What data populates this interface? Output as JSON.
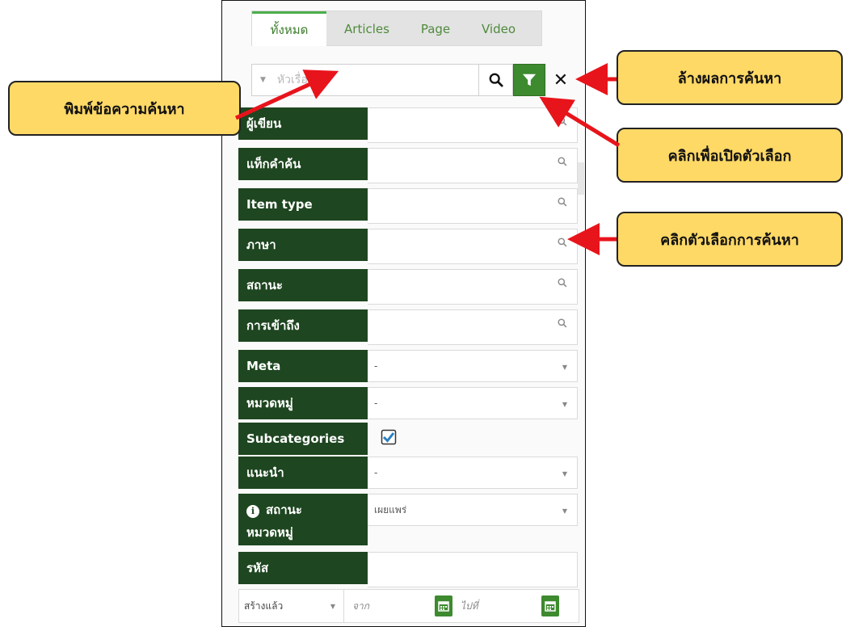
{
  "tabs": [
    "ทั้งหมด",
    "Articles",
    "Page",
    "Video"
  ],
  "search": {
    "placeholder": "หัวเรื่อง"
  },
  "filters": {
    "author": "ผู้เขียน",
    "tags": "แท็กคำค้น",
    "item_type": "Item type",
    "language": "ภาษา",
    "status": "สถานะ",
    "access": "การเข้าถึง",
    "meta": {
      "label": "Meta",
      "value": "-"
    },
    "category": {
      "label": "หมวดหมู่",
      "value": "-"
    },
    "subcategories": {
      "label": "Subcategories",
      "checked": true
    },
    "featured": {
      "label": "แนะนำ",
      "value": "-"
    },
    "category_status": {
      "label_line1": "สถานะ",
      "label_line2": "หมวดหมู่",
      "value": "เผยแพร่"
    },
    "id": "รหัส",
    "date": {
      "type": "สร้างแล้ว",
      "from_placeholder": "จาก",
      "to_placeholder": "ไปที่"
    }
  },
  "callouts": {
    "type_search": "พิมพ์ข้อความค้นหา",
    "clear_results": "ล้างผลการค้นหา",
    "open_options": "คลิกเพื่อเปิดตัวเลือก",
    "search_options": "คลิกตัวเลือกการค้นหา"
  },
  "colors": {
    "label_bg": "#1e4620",
    "accent_green": "#3d8a2f",
    "callout_bg": "#ffd966",
    "arrow": "#e8141b"
  }
}
